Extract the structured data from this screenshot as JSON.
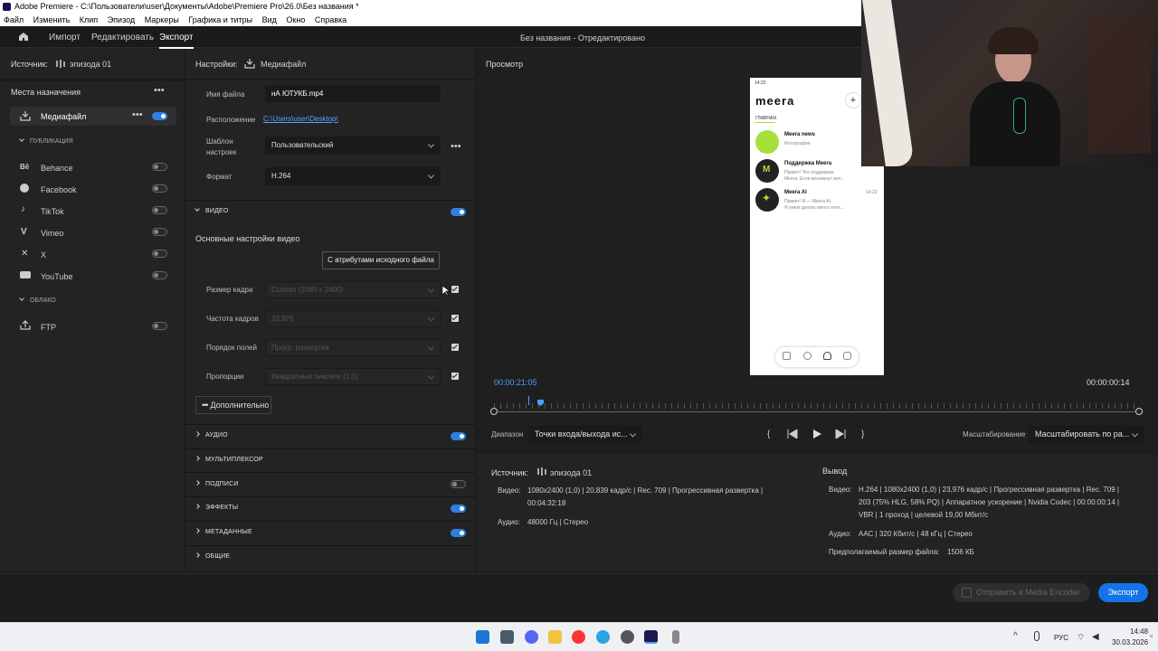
{
  "window": {
    "title": "Adobe Premiere - C:\\Пользователи\\user\\Документы\\Adobe\\Premiere Pro\\26.0\\Без названия *"
  },
  "menu": [
    "Файл",
    "Изменить",
    "Клип",
    "Эпизод",
    "Маркеры",
    "Графика и титры",
    "Вид",
    "Окно",
    "Справка"
  ],
  "nav": {
    "import": "Импорт",
    "edit": "Редактировать",
    "export": "Экспорт",
    "project": "Без названия - Отредактировано"
  },
  "source": {
    "label": "Источник:",
    "name": "эпизода 01"
  },
  "destinations": {
    "heading": "Места назначения",
    "media_file": "Медиафайл",
    "publish_heading": "ПУБЛИКАЦИЯ",
    "publish": [
      "Behance",
      "Facebook",
      "TikTok",
      "Vimeo",
      "X",
      "YouTube"
    ],
    "cloud_heading": "ОБЛАКО",
    "cloud": [
      "FTP"
    ]
  },
  "settings": {
    "heading": "Настройки:",
    "target": "Медиафайл",
    "filename_label": "Имя файла",
    "filename": "нА ЮТУКБ.mp4",
    "location_label": "Расположение",
    "location": "C:\\Users\\user\\Desktop\\",
    "preset_label_1": "Шаблон",
    "preset_label_2": "настроек",
    "preset": "Пользовательский",
    "format_label": "Формат",
    "format": "H.264",
    "video_section": "ВИДЕО",
    "basic_video": "Основные настройки видео",
    "match_source": "С атрибутами исходного файла",
    "frame_size_label": "Размер кадра",
    "frame_size": "Custom (1080 x 2400)",
    "frame_rate_label": "Частота кадров",
    "frame_rate": "23,976",
    "field_order_label": "Порядок полей",
    "field_order": "Прогр. развертка",
    "aspect_label": "Пропорции",
    "aspect": "Квадратные пиксели (1,0)",
    "more": "Дополнительно",
    "sections": [
      "АУДИО",
      "МУЛЬТИПЛЕКСОР",
      "ПОДПИСИ",
      "ЭФФЕКТЫ",
      "МЕТАДАННЫЕ",
      "ОБЩИЕ"
    ]
  },
  "preview": {
    "heading": "Просмотр",
    "timecode_in": "00:00:21:05",
    "timecode_dur": "00:00:00:14",
    "range_label": "Диапазон",
    "range": "Точки входа/выхода ис...",
    "scale_label": "Масштабирование",
    "scale": "Масштабировать по ра..."
  },
  "phone": {
    "status": "14:22",
    "app": "meera",
    "section": "ГЛАВНАЯ",
    "chats": [
      {
        "name": "Meera news",
        "msg": "Фотография",
        "time": ""
      },
      {
        "name": "Поддержка Meera",
        "msg": "Привет! Это поддержка",
        "msg2": "Meera. Если возникнут воп...",
        "time": ""
      },
      {
        "name": "Meera AI",
        "msg": "Привет! Я — Meera AI.",
        "msg2": "Я умею делать много инте...",
        "time": "14:22"
      }
    ]
  },
  "summary": {
    "source_label": "Источник:",
    "source_name": "эпизода 01",
    "video_label": "Видео:",
    "src_video_1": "1080x2400 (1,0)  |  20,839 кадр/с  |  Rec. 709  |  Прогрессивная развертка  |",
    "src_video_2": "00:04:32:18",
    "audio_label": "Аудио:",
    "src_audio": "48000 Гц  |  Стерео",
    "output_label": "Вывод",
    "out_video_1": "H.264  |  1080x2400 (1,0)  |  23,976 кадр/с  |  Прогрессивная развертка  |  Rec. 709  |",
    "out_video_2": "203 (75% HLG, 58% PQ)  |  Аппаратное ускорение  |  Nvidia Codec  |  00:00:00:14  |",
    "out_video_3": "VBR  |  1 проход  |  целевой 19,00 Мбит/с",
    "out_audio": "AAC  |  320 Кбит/с  |  48 кГц  |  Стерео",
    "size_label": "Предполагаемый размер файла:",
    "size": "1506 КБ"
  },
  "buttons": {
    "media_encoder": "Отправить в Media Encoder",
    "export": "Экспорт"
  },
  "taskbar": {
    "lang": "РУС",
    "time": "14:48",
    "date": "30.03.2026"
  }
}
